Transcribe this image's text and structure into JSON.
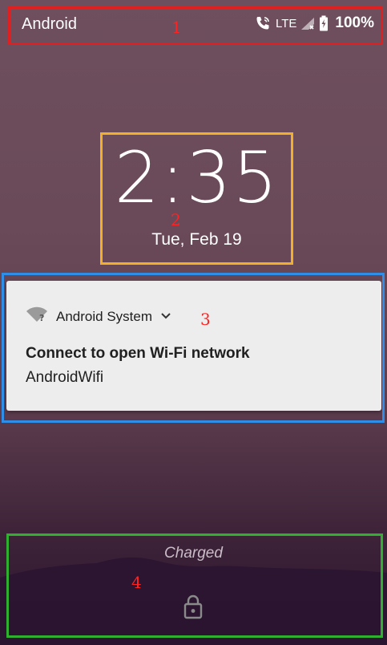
{
  "status_bar": {
    "carrier": "Android",
    "network": "LTE",
    "battery_percent": "100%",
    "icons": [
      "wifi-calling-icon",
      "signal-no-service-icon",
      "battery-charging-icon"
    ]
  },
  "clock": {
    "time": "2:35",
    "date": "Tue, Feb 19"
  },
  "notification": {
    "app_name": "Android System",
    "title": "Connect to open Wi-Fi network",
    "text": "AndroidWifi",
    "icons": [
      "wifi-question-icon",
      "expand-chevron-icon"
    ]
  },
  "bottom": {
    "charging_status": "Charged",
    "icons": [
      "lock-icon"
    ]
  },
  "annotations": [
    {
      "label": "1",
      "color": "#e02020"
    },
    {
      "label": "2",
      "color": "#f2b02a"
    },
    {
      "label": "3",
      "color": "#2f8fe8"
    },
    {
      "label": "4",
      "color": "#2fb02f"
    }
  ]
}
